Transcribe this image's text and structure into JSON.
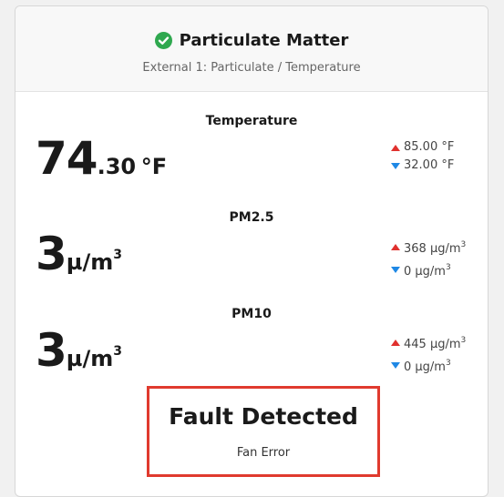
{
  "header": {
    "title": "Particulate Matter",
    "subtitle": "External 1: Particulate / Temperature",
    "status_icon": "check-circle-icon",
    "status_color": "#2fa84f"
  },
  "readings": [
    {
      "label": "Temperature",
      "value_main": "74",
      "value_frac": ".30",
      "unit": "°F",
      "high": "85.00 °F",
      "low": "32.00 °F"
    },
    {
      "label": "PM2.5",
      "value_main": "3",
      "unit_base": "µ/m",
      "unit_exp": "3",
      "high_value": "368 µg/m",
      "high_exp": "3",
      "low_value": "0 µg/m",
      "low_exp": "3"
    },
    {
      "label": "PM10",
      "value_main": "3",
      "unit_base": "µ/m",
      "unit_exp": "3",
      "high_value": "445 µg/m",
      "high_exp": "3",
      "low_value": "0 µg/m",
      "low_exp": "3"
    }
  ],
  "fault": {
    "title": "Fault Detected",
    "message": "Fan Error",
    "border_color": "#e03a2e"
  },
  "colors": {
    "high_indicator": "#e0312e",
    "low_indicator": "#1e88e5"
  }
}
